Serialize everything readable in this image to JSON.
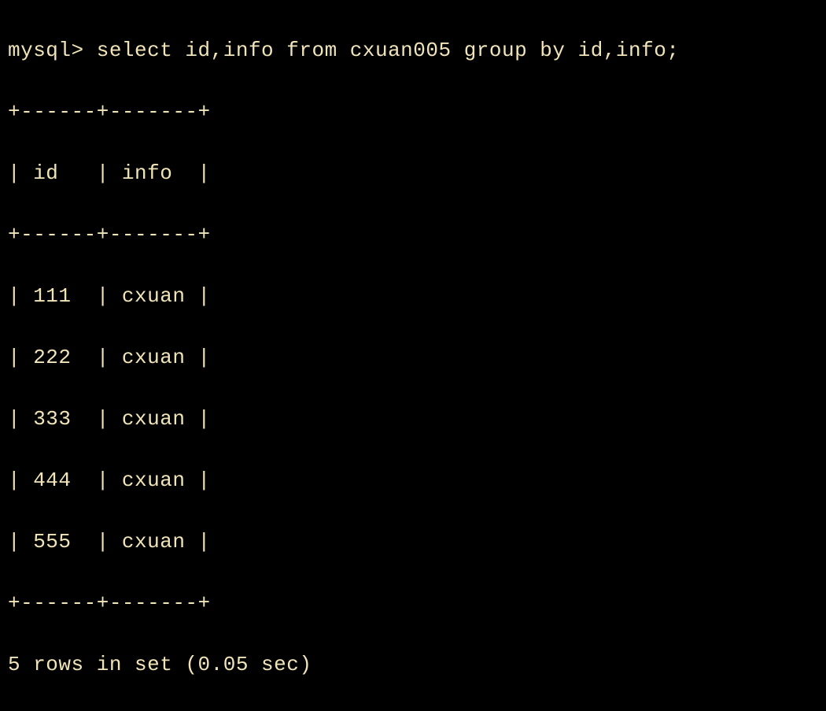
{
  "terminal": {
    "prompt": "mysql> ",
    "query": "select id,info from cxuan005 group by id,info;",
    "table": {
      "border_top": "+------+-------+",
      "border_mid": "+------+-------+",
      "border_bottom": "+------+-------+",
      "header": "| id   | info  |",
      "col_id": "id",
      "col_info": "info",
      "rows": [
        "| 111  | cxuan |",
        "| 222  | cxuan |",
        "| 333  | cxuan |",
        "| 444  | cxuan |",
        "| 555  | cxuan |"
      ],
      "row_values": [
        {
          "id": "111",
          "info": "cxuan"
        },
        {
          "id": "222",
          "info": "cxuan"
        },
        {
          "id": "333",
          "info": "cxuan"
        },
        {
          "id": "444",
          "info": "cxuan"
        },
        {
          "id": "555",
          "info": "cxuan"
        }
      ]
    },
    "status": "5 rows in set (0.05 sec)"
  }
}
